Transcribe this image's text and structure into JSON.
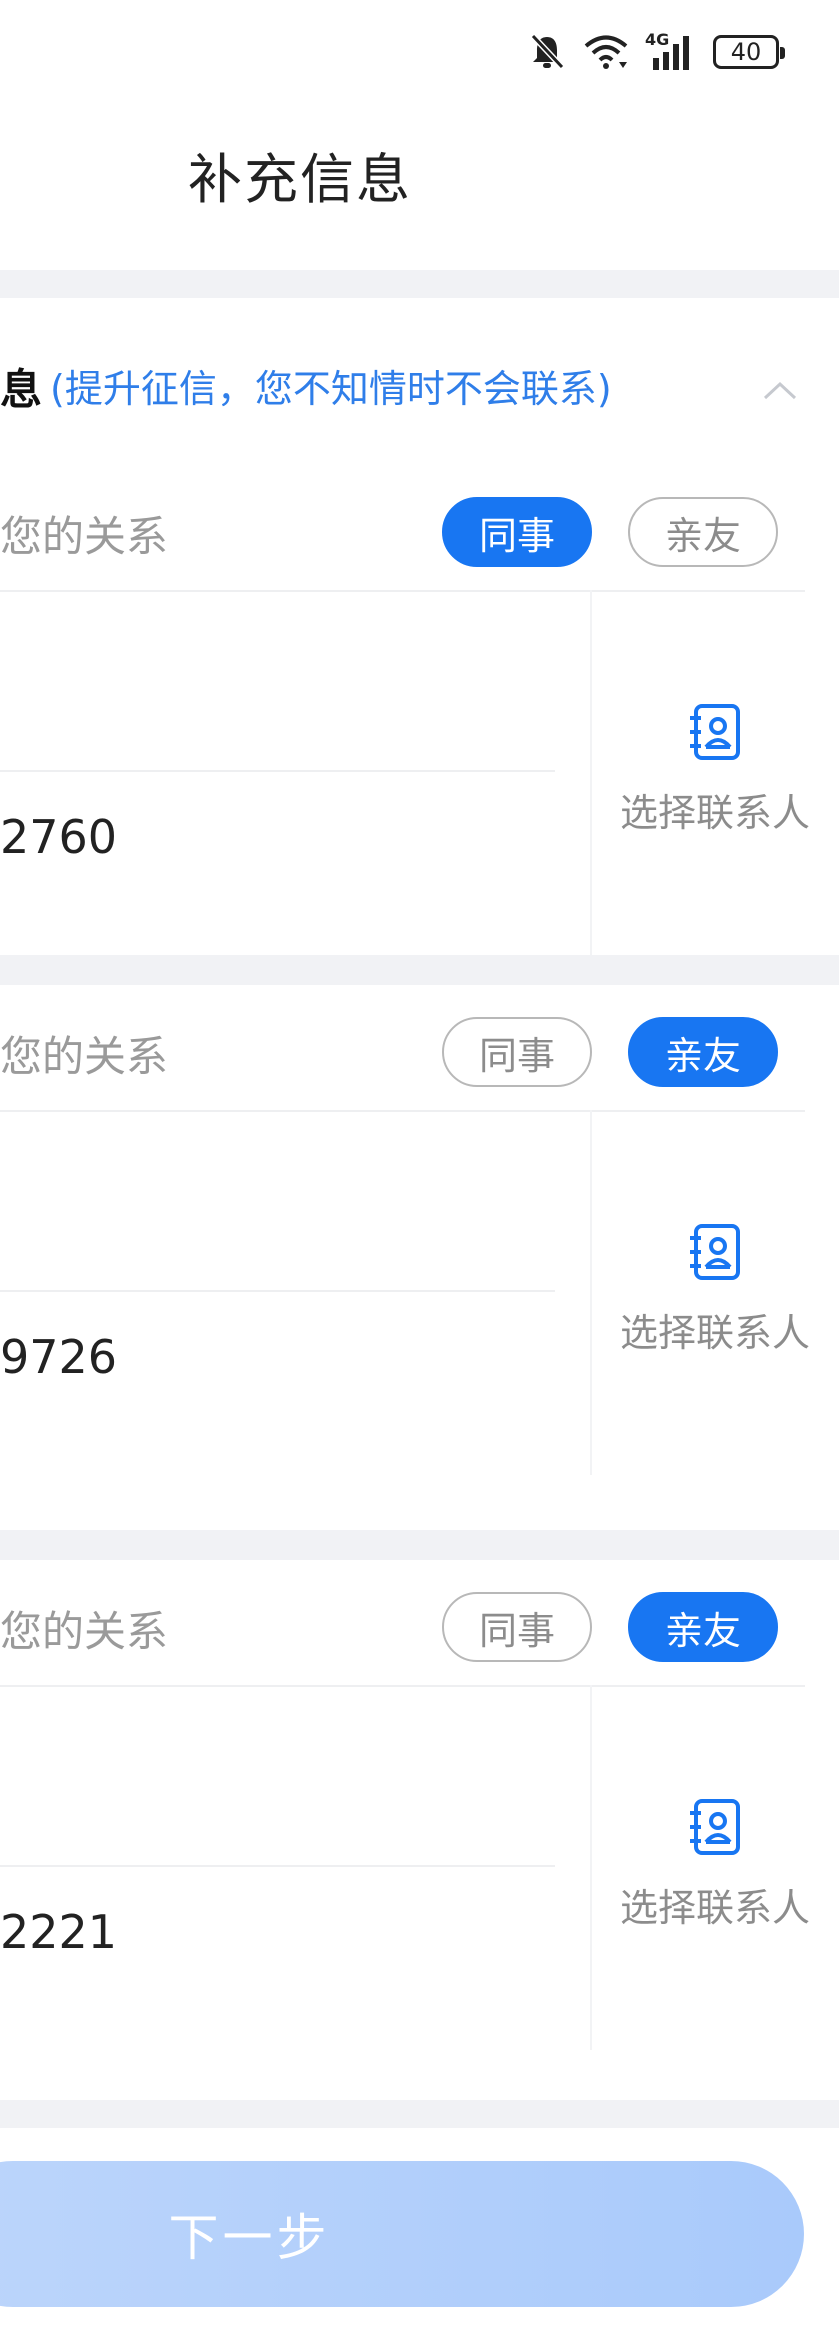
{
  "status_bar": {
    "network": "4G",
    "battery": "40"
  },
  "header": {
    "title": "补充信息"
  },
  "section": {
    "title": "息",
    "note": "(提升征信，您不知情时不会联系)"
  },
  "contacts": [
    {
      "relation_label": "您的关系",
      "option_a": "同事",
      "option_b": "亲友",
      "selected": "同事",
      "name": "",
      "phone": "2760",
      "picker_label": "选择联系人"
    },
    {
      "relation_label": "您的关系",
      "option_a": "同事",
      "option_b": "亲友",
      "selected": "亲友",
      "name": "",
      "phone": "9726",
      "picker_label": "选择联系人"
    },
    {
      "relation_label": "您的关系",
      "option_a": "同事",
      "option_b": "亲友",
      "selected": "亲友",
      "name": "",
      "phone": "2221",
      "picker_label": "选择联系人"
    }
  ],
  "footer": {
    "next_label": "下一步"
  },
  "colors": {
    "accent": "#1876f2",
    "note": "#2f7ee9",
    "muted": "#8c8c8c",
    "gap": "#f1f2f5",
    "button": "#bcd5fb"
  },
  "icons": {
    "mute": "bell-off-icon",
    "wifi": "wifi-icon",
    "signal": "signal-icon",
    "battery": "battery-icon",
    "collapse": "chevron-up-icon",
    "picker": "contact-book-icon"
  }
}
